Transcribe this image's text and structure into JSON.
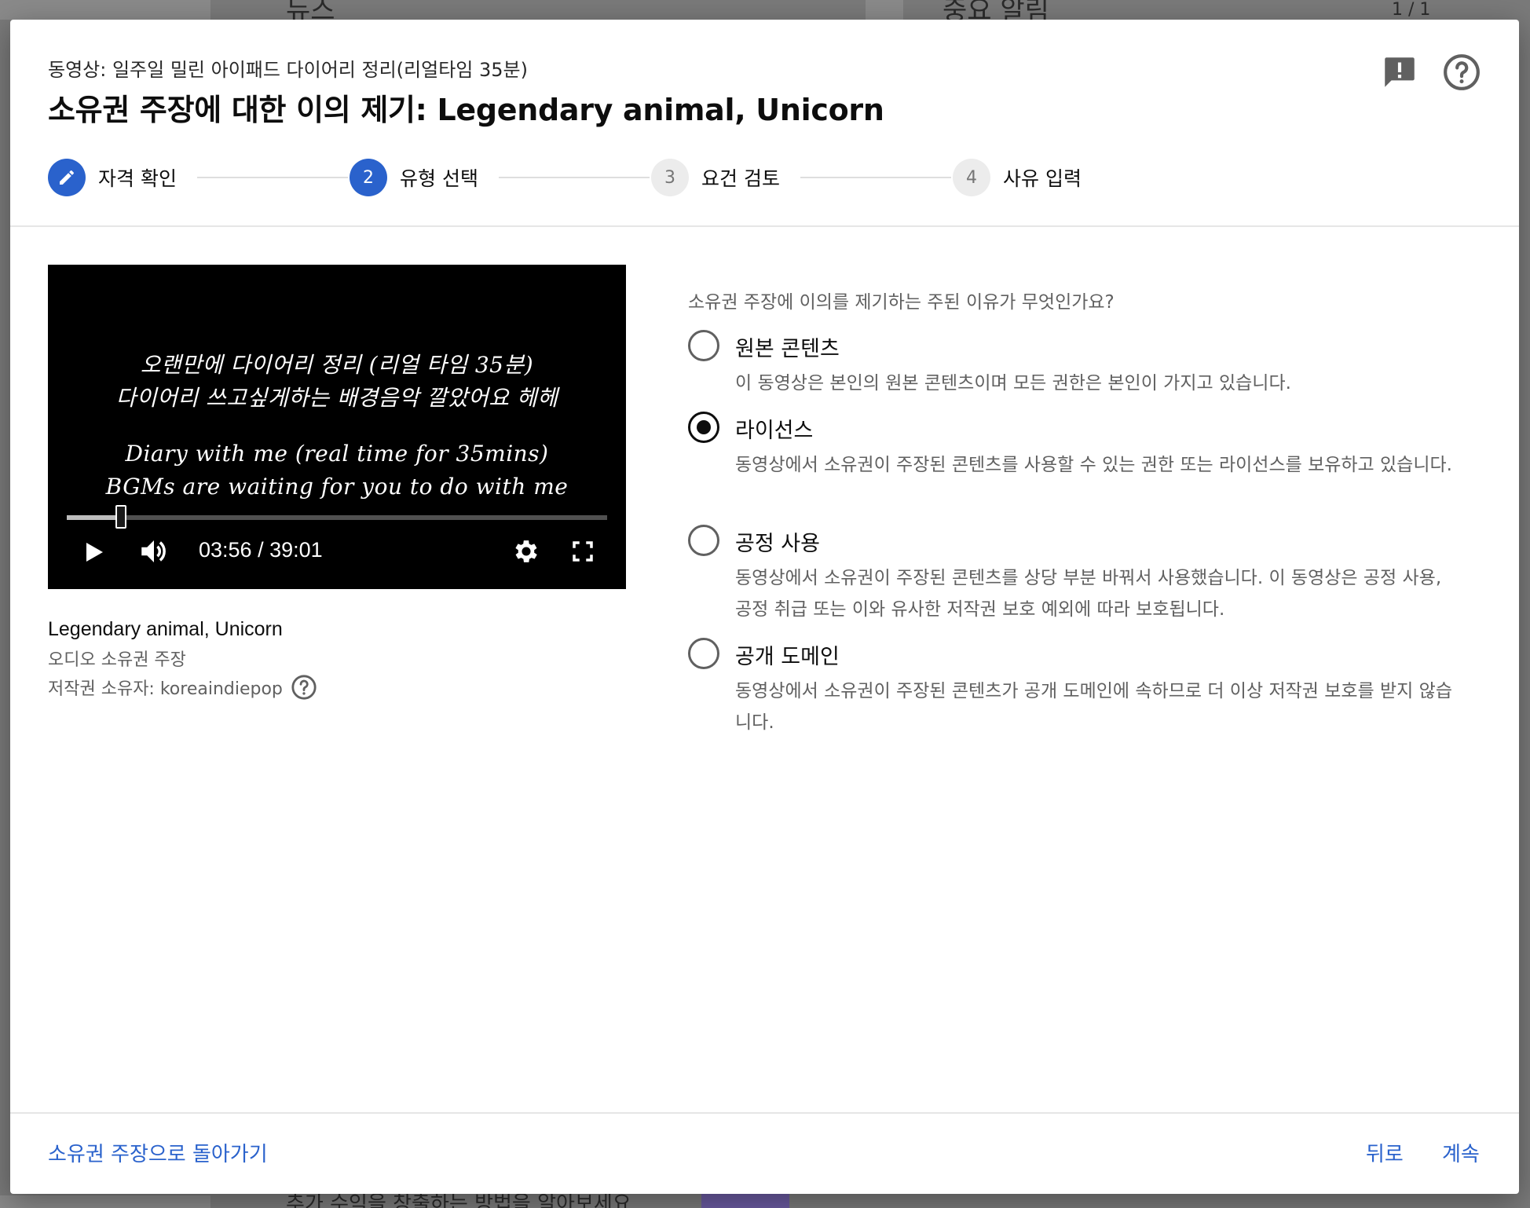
{
  "background": {
    "news_heading": "뉴스",
    "alerts_heading": "중요 알림",
    "alerts_pager": "1 / 1",
    "bottom_text": "추가 수익을 창출하는 방법을 알아보세요"
  },
  "dialog": {
    "subtitle": "동영상: 일주일 밀린 아이패드 다이어리 정리(리얼타임 35분)",
    "title": "소유권 주장에 대한 이의 제기: Legendary animal, Unicorn",
    "icons": {
      "feedback": "feedback-icon",
      "help": "help-icon"
    }
  },
  "stepper": {
    "steps": [
      {
        "number": "",
        "label": "자격 확인",
        "state": "done"
      },
      {
        "number": "2",
        "label": "유형 선택",
        "state": "active"
      },
      {
        "number": "3",
        "label": "요건 검토",
        "state": "inactive"
      },
      {
        "number": "4",
        "label": "사유 입력",
        "state": "inactive"
      }
    ]
  },
  "player": {
    "captions": [
      "오랜만에 다이어리 정리 (리얼 타임 35분)",
      "다이어리 쓰고싶게하는 배경음악 깔았어요 헤헤",
      "Diary with me (real time for 35mins)",
      "BGMs are waiting for you to do with me"
    ],
    "current_time": "03:56",
    "duration": "39:01",
    "time_display": "03:56 / 39:01",
    "progress_fraction": 0.1008,
    "icons": [
      "play-icon",
      "volume-icon",
      "settings-icon",
      "fullscreen-icon"
    ]
  },
  "claim": {
    "asset_title": "Legendary animal, Unicorn",
    "claim_type": "오디오 소유권 주장",
    "owner_label": "저작권 소유자: koreaindiepop"
  },
  "dispute": {
    "question": "소유권 주장에 이의를 제기하는 주된 이유가 무엇인가요?",
    "selected": "license",
    "options": [
      {
        "id": "original",
        "label": "원본 콘텐츠",
        "description": "이 동영상은 본인의 원본 콘텐츠이며 모든 권한은 본인이 가지고 있습니다."
      },
      {
        "id": "license",
        "label": "라이선스",
        "description": "동영상에서 소유권이 주장된 콘텐츠를 사용할 수 있는 권한 또는 라이선스를 보유하고 있습니다."
      },
      {
        "id": "fair_use",
        "label": "공정 사용",
        "description": "동영상에서 소유권이 주장된 콘텐츠를 상당 부분 바꿔서 사용했습니다. 이 동영상은 공정 사용, 공정 취급 또는 이와 유사한 저작권 보호 예외에 따라 보호됩니다."
      },
      {
        "id": "public_domain",
        "label": "공개 도메인",
        "description": "동영상에서 소유권이 주장된 콘텐츠가 공개 도메인에 속하므로 더 이상 저작권 보호를 받지 않습니다."
      }
    ]
  },
  "footer": {
    "back_to_claims": "소유권 주장으로 돌아가기",
    "back": "뒤로",
    "continue": "계속"
  },
  "colors": {
    "accent": "#2a62cc",
    "text_primary": "#0d0d0d",
    "text_secondary": "#606060",
    "overlay": "#7f7f7f"
  }
}
